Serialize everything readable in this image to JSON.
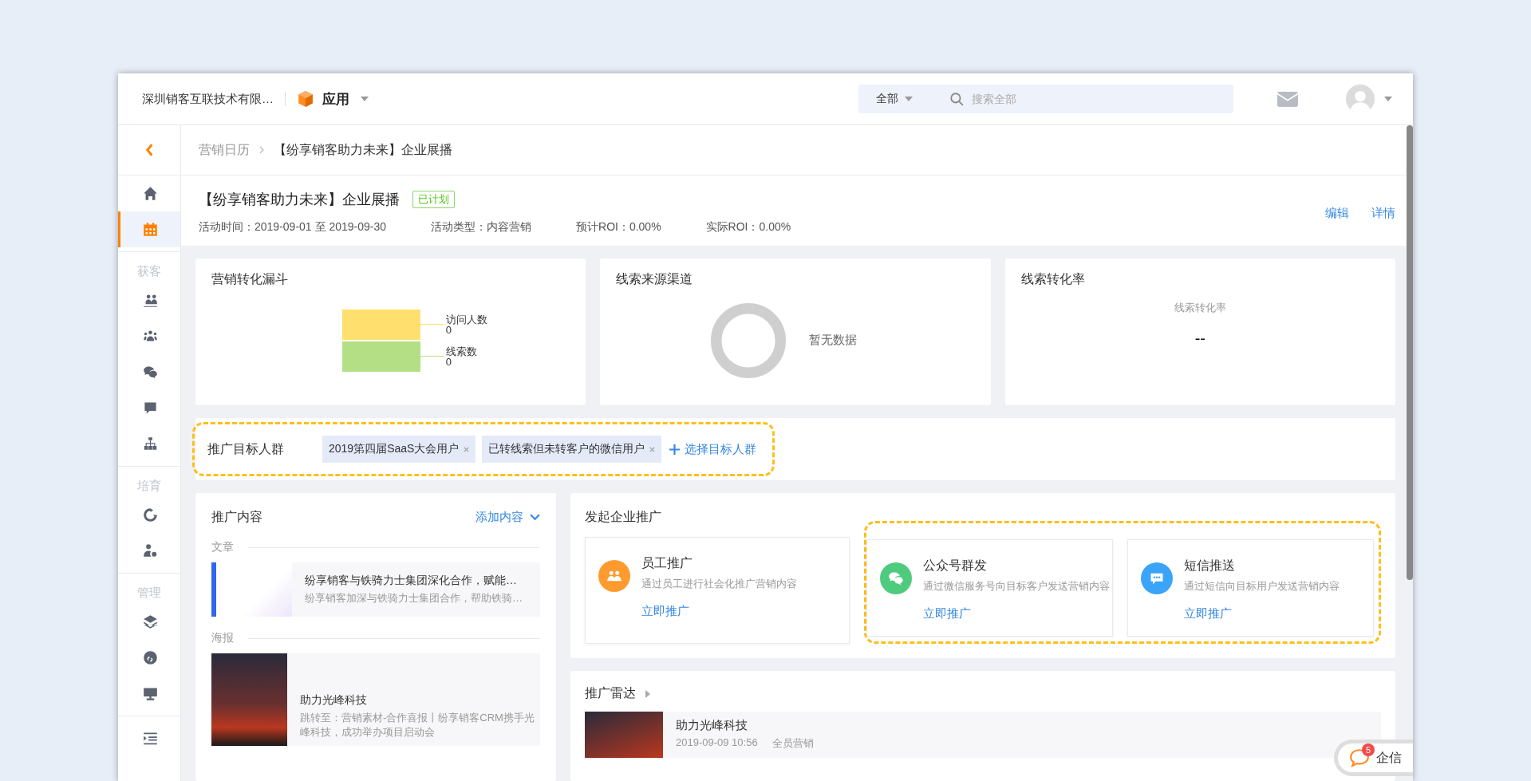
{
  "header": {
    "company": "深圳销客互联技术有限…",
    "app_menu": "应用",
    "search_scope": "全部",
    "search": {
      "placeholder": "搜索全部"
    }
  },
  "sidebar": {
    "top_items": [
      {
        "selected": false
      },
      {
        "selected": true
      }
    ],
    "sections": [
      {
        "label": "获客",
        "items": [
          {
            "selected": false
          },
          {
            "selected": false
          },
          {
            "selected": false
          },
          {
            "selected": false
          },
          {
            "selected": false
          }
        ]
      },
      {
        "label": "培育",
        "items": [
          {
            "selected": false
          },
          {
            "selected": false
          }
        ]
      },
      {
        "label": "管理",
        "items": [
          {
            "selected": false
          },
          {
            "selected": false
          },
          {
            "selected": false
          }
        ]
      }
    ]
  },
  "breadcrumb": [
    "营销日历",
    "【纷享销客助力未来】企业展播"
  ],
  "activity": {
    "title": "【纷享销客助力未来】企业展播",
    "status": "已计划",
    "meta": [
      "活动时间：2019-09-01 至 2019-09-30",
      "活动类型：内容营销",
      "预计ROI：0.00%",
      "实际ROI：0.00%"
    ],
    "actions": [
      "编辑",
      "详情"
    ]
  },
  "stats": [
    {
      "kind": "funnel",
      "title": "营销转化漏斗",
      "legend": [
        {
          "label": "访问人数",
          "value": "0",
          "color": "#ffdf6e"
        },
        {
          "label": "线索数",
          "value": "0",
          "color": "#b5df84"
        }
      ]
    },
    {
      "kind": "donut",
      "title": "线索来源渠道",
      "empty_text": "暂无数据"
    },
    {
      "kind": "rate",
      "title": "线索转化率",
      "caption": "线索转化率",
      "value": "--"
    }
  ],
  "target": {
    "label": "推广目标人群",
    "tags": [
      "2019第四届SaaS大会用户",
      "已转线索但未转客户的微信用户"
    ],
    "add": "选择目标人群"
  },
  "content": {
    "title": "推广内容",
    "add": "添加内容",
    "groups": [
      {
        "label": "文章",
        "kind": "article",
        "items": [
          {
            "title": "纷享销客与铁骑力士集团深化合作，赋能…",
            "desc": "纷享销客加深与铁骑力士集团合作，帮助铁骑…"
          }
        ]
      },
      {
        "label": "海报",
        "kind": "poster",
        "items": [
          {
            "title": "助力光峰科技",
            "desc": "跳转至：营销素材-合作喜报丨纷享销客CRM携手光峰科技，成功举办项目启动会"
          }
        ]
      }
    ]
  },
  "launch": {
    "title": "发起企业推广",
    "channels": [
      {
        "kind": "staff",
        "name": "员工推广",
        "desc": "通过员工进行社会化推广营销内容",
        "action": "立即推广",
        "color": "#ff9a2e",
        "highlighted": false
      },
      {
        "kind": "wechat",
        "name": "公众号群发",
        "desc": "通过微信服务号向目标客户发送营销内容",
        "action": "立即推广",
        "color": "#4fcb7d",
        "highlighted": true
      },
      {
        "kind": "sms",
        "name": "短信推送",
        "desc": "通过短信向目标用户发送营销内容",
        "action": "立即推广",
        "color": "#3aa4f8",
        "highlighted": true
      }
    ]
  },
  "radar": {
    "title": "推广雷达",
    "items": [
      {
        "title": "助力光峰科技",
        "date": "2019-09-09 10:56",
        "scope": "全员营销"
      }
    ]
  },
  "chat": {
    "label": "企信",
    "badge": "5"
  }
}
